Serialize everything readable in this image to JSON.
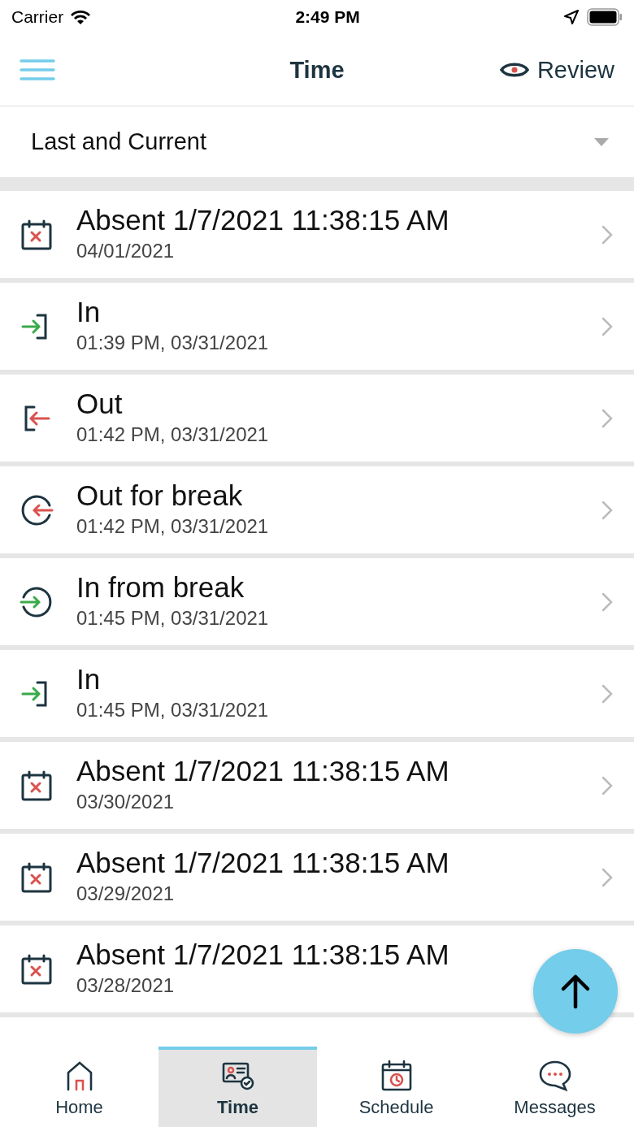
{
  "status_bar": {
    "carrier": "Carrier",
    "time": "2:49 PM"
  },
  "nav": {
    "title": "Time",
    "action": "Review"
  },
  "filter": {
    "value": "Last and Current"
  },
  "entries": [
    {
      "kind": "absent",
      "title": "Absent 1/7/2021 11:38:15 AM",
      "subtitle": "04/01/2021"
    },
    {
      "kind": "in",
      "title": "In",
      "subtitle": "01:39 PM, 03/31/2021"
    },
    {
      "kind": "out",
      "title": "Out",
      "subtitle": "01:42 PM, 03/31/2021"
    },
    {
      "kind": "break_out",
      "title": "Out for break",
      "subtitle": "01:42 PM, 03/31/2021"
    },
    {
      "kind": "break_in",
      "title": "In from break",
      "subtitle": "01:45 PM, 03/31/2021"
    },
    {
      "kind": "in",
      "title": "In",
      "subtitle": "01:45 PM, 03/31/2021"
    },
    {
      "kind": "absent",
      "title": "Absent 1/7/2021 11:38:15 AM",
      "subtitle": "03/30/2021"
    },
    {
      "kind": "absent",
      "title": "Absent 1/7/2021 11:38:15 AM",
      "subtitle": "03/29/2021"
    },
    {
      "kind": "absent",
      "title": "Absent 1/7/2021 11:38:15 AM",
      "subtitle": "03/28/2021"
    }
  ],
  "tabs": [
    {
      "kind": "home",
      "label": "Home",
      "selected": false
    },
    {
      "kind": "time",
      "label": "Time",
      "selected": true
    },
    {
      "kind": "schedule",
      "label": "Schedule",
      "selected": false
    },
    {
      "kind": "messages",
      "label": "Messages",
      "selected": false
    }
  ]
}
